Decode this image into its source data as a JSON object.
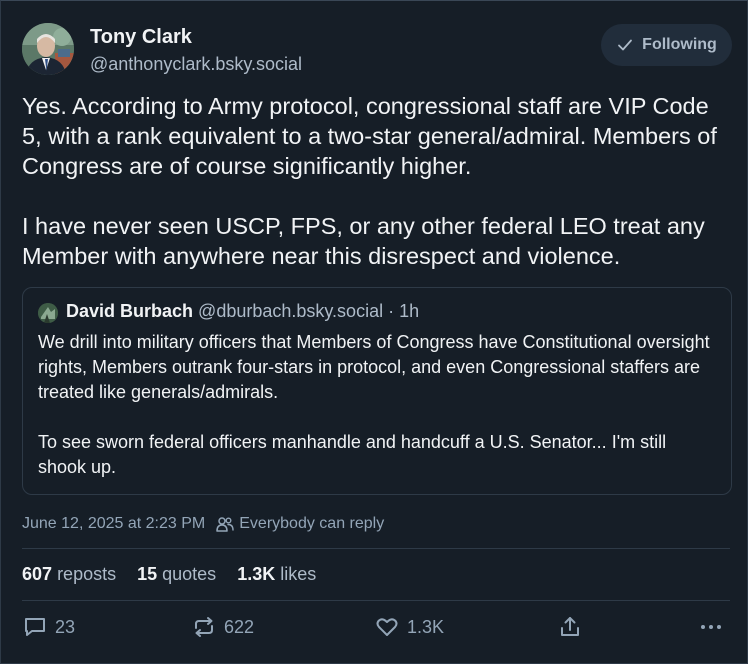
{
  "author": {
    "display_name": "Tony Clark",
    "handle": "@anthonyclark.bsky.social",
    "follow_label": "Following"
  },
  "post": {
    "text": "Yes. According to Army protocol, congressional staff are VIP Code 5, with a rank equivalent to a two-star general/admiral. Members of Congress are of course significantly higher.\n\nI have never seen USCP, FPS, or any other federal LEO treat any Member with anywhere near this disrespect and violence."
  },
  "quote": {
    "display_name": "David Burbach",
    "handle": "@dburbach.bsky.social",
    "time": "· 1h",
    "text": "We drill into military officers that Members of Congress have Constitutional oversight rights, Members outrank four-stars in protocol, and even Congressional staffers are treated like generals/admirals.\n\nTo see sworn federal officers manhandle and handcuff a U.S. Senator... I'm still shook up."
  },
  "meta": {
    "timestamp": "June 12, 2025 at 2:23 PM",
    "reply_setting": "Everybody can reply"
  },
  "stats": {
    "reposts_count": "607",
    "reposts_label": "reposts",
    "quotes_count": "15",
    "quotes_label": "quotes",
    "likes_count": "1.3K",
    "likes_label": "likes"
  },
  "actions": {
    "reply_count": "23",
    "repost_count": "622",
    "like_count": "1.3K"
  },
  "colors": {
    "background": "#161e27",
    "primary_text": "#f1f3f5",
    "secondary_text": "#aebbc9",
    "border": "#2e3a47"
  }
}
